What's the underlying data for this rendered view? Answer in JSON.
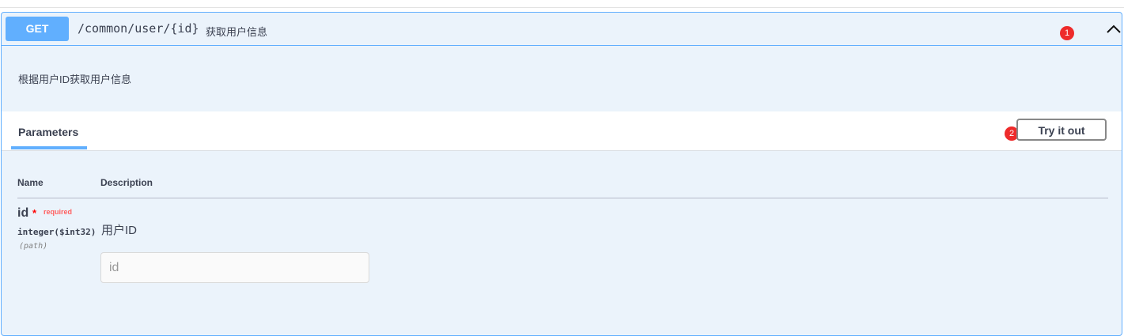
{
  "operation": {
    "method": "GET",
    "path": "/common/user/{id}",
    "summary": "获取用户信息",
    "description": "根据用户ID获取用户信息",
    "collapse_icon": "chevron-up-icon"
  },
  "annotations": {
    "badge1": "1",
    "badge2": "2"
  },
  "parameters_section": {
    "tab_label": "Parameters",
    "try_it_out_label": "Try it out",
    "columns": [
      "Name",
      "Description"
    ],
    "params": [
      {
        "name": "id",
        "required_marker": "*",
        "required_label": "required",
        "type": "integer($int32)",
        "location": "(path)",
        "description": "用户ID",
        "input_placeholder": "id",
        "input_value": ""
      }
    ]
  },
  "colors": {
    "get_accent": "#61affe",
    "background": "#ebf3fb",
    "badge": "#ee2b2b",
    "required": "#ff0000"
  }
}
